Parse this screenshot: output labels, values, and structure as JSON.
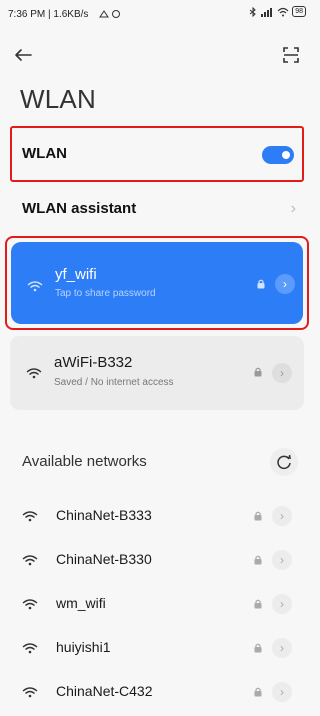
{
  "status": {
    "left": "7:36 PM | 1.6KB/s",
    "battery": "98"
  },
  "header": {
    "title": "WLAN"
  },
  "wlan_toggle": {
    "label": "WLAN",
    "on": true
  },
  "assistant": {
    "label": "WLAN assistant"
  },
  "connected": {
    "name": "yf_wifi",
    "sub": "Tap to share password"
  },
  "saved": {
    "name": "aWiFi-B332",
    "sub": "Saved / No internet access"
  },
  "available": {
    "label": "Available networks",
    "networks": [
      {
        "name": "ChinaNet-B333"
      },
      {
        "name": "ChinaNet-B330"
      },
      {
        "name": "wm_wifi"
      },
      {
        "name": "huiyishi1"
      },
      {
        "name": "ChinaNet-C432"
      }
    ]
  },
  "colors": {
    "accent": "#2c7df6",
    "highlight": "#e31b1b"
  }
}
